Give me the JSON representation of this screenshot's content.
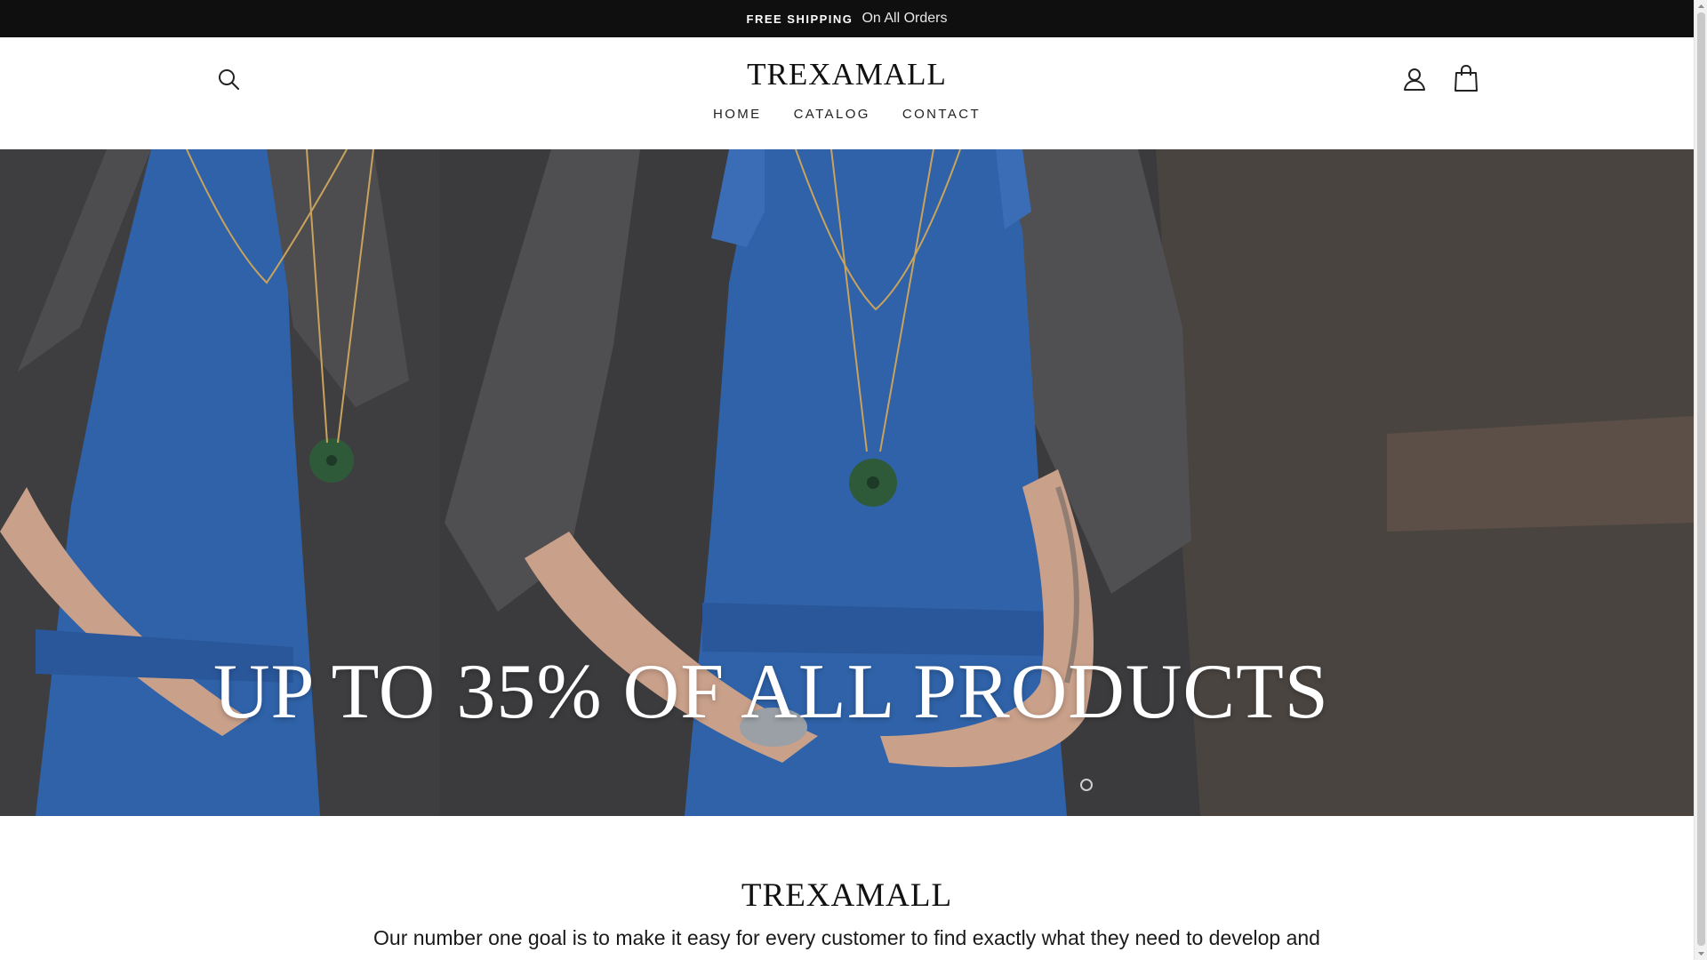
{
  "announcement": {
    "bold": "FREE SHIPPING",
    "text": "On All Orders"
  },
  "header": {
    "logo": "TREXAMALL",
    "nav": [
      {
        "label": "HOME"
      },
      {
        "label": "CATALOG"
      },
      {
        "label": "CONTACT"
      }
    ],
    "icons": [
      "search-icon",
      "user-icon",
      "shopping-bag-icon"
    ]
  },
  "hero": {
    "heading": "UP TO 35% OF ALL PRODUCTS"
  },
  "about": {
    "title": "TREXAMALL",
    "text": "Our number one goal is to make it easy for every customer to find exactly what they need to develop and"
  },
  "colors": {
    "announcement_bg": "#0f0f0f",
    "apron_blue": "#2f62a8",
    "shirt_gray": "#4b4b4d",
    "text_dark": "#111111"
  }
}
